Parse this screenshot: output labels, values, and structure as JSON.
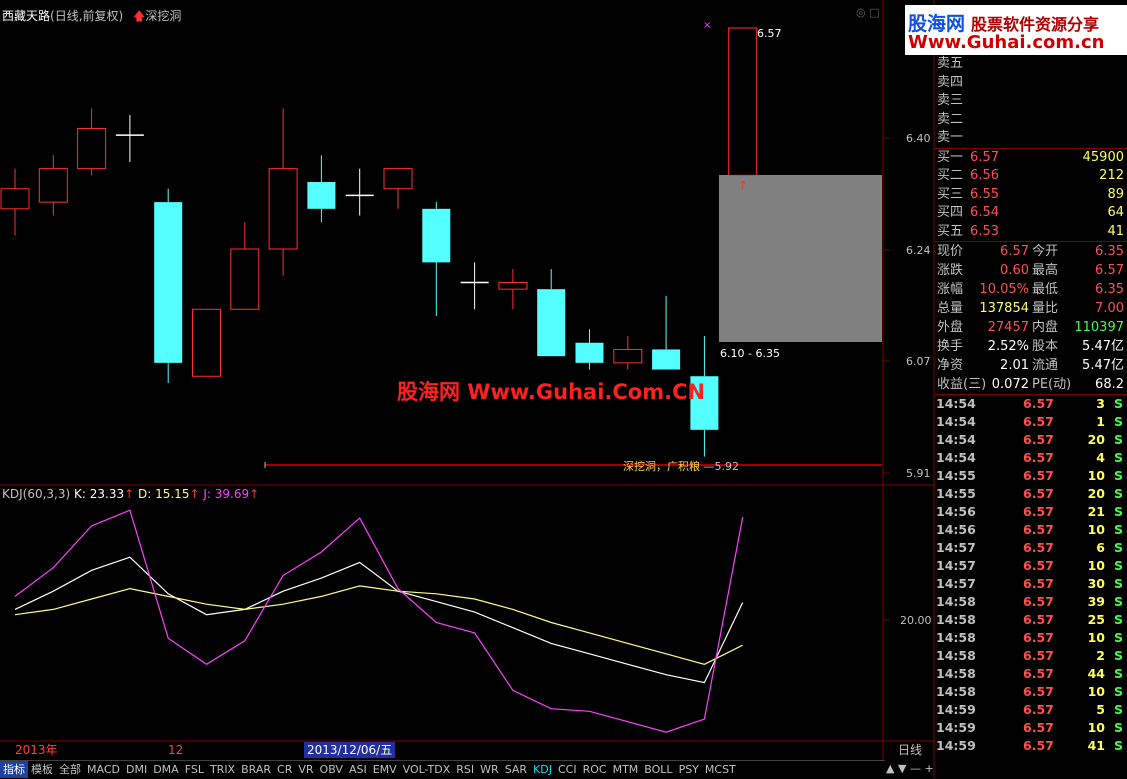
{
  "title": {
    "stock_name": "西藏天路",
    "period": "(日线,前复权)",
    "formula_name": "深挖洞"
  },
  "kdj_header": {
    "name": "KDJ(60,3,3)",
    "k_label": "K: 23.33",
    "d_label": "D: 15.15",
    "j_label": "J: 39.69",
    "arrow": "↑"
  },
  "price_axis": [
    "6.40",
    "6.24",
    "6.07",
    "5.91"
  ],
  "kdj_axis": [
    "20.00"
  ],
  "annotations": {
    "high_label": "6.57",
    "zone_label": "6.10 - 6.35",
    "support_text": "深挖洞，广积粮",
    "support_value": "5.92",
    "high_marker": "×"
  },
  "watermark": "股海网 Www.Guhai.Com.CN",
  "logo": {
    "line1": "股海网",
    "line1_sub": "股票软件资源分享",
    "line2": "Www.Guhai.com.cn"
  },
  "date_bar": {
    "year": "2013年",
    "month": "12",
    "cursor_date": "2013/12/06/五"
  },
  "period_button": "日线",
  "bottom_tabs": [
    "指标",
    "模板",
    "全部",
    "MACD",
    "DMI",
    "DMA",
    "FSL",
    "TRIX",
    "BRAR",
    "CR",
    "VR",
    "OBV",
    "ASI",
    "EMV",
    "VOL-TDX",
    "RSI",
    "WR",
    "SAR",
    "KDJ",
    "CCI",
    "ROC",
    "MTM",
    "BOLL",
    "PSY",
    "MCST"
  ],
  "active_tab": "KDJ",
  "sell_orders": [
    {
      "label": "卖五"
    },
    {
      "label": "卖四"
    },
    {
      "label": "卖三"
    },
    {
      "label": "卖二"
    },
    {
      "label": "卖一"
    }
  ],
  "buy_orders": [
    {
      "label": "买一",
      "price": "6.57",
      "volume": "45900"
    },
    {
      "label": "买二",
      "price": "6.56",
      "volume": "212"
    },
    {
      "label": "买三",
      "price": "6.55",
      "volume": "89"
    },
    {
      "label": "买四",
      "price": "6.54",
      "volume": "64"
    },
    {
      "label": "买五",
      "price": "6.53",
      "volume": "41"
    }
  ],
  "stats": [
    {
      "l1": "现价",
      "v1": "6.57",
      "c1": "red",
      "l2": "今开",
      "v2": "6.35",
      "c2": "red"
    },
    {
      "l1": "涨跌",
      "v1": "0.60",
      "c1": "red",
      "l2": "最高",
      "v2": "6.57",
      "c2": "red"
    },
    {
      "l1": "涨幅",
      "v1": "10.05%",
      "c1": "red",
      "l2": "最低",
      "v2": "6.35",
      "c2": "red"
    },
    {
      "l1": "总量",
      "v1": "137854",
      "c1": "yellow",
      "l2": "量比",
      "v2": "7.00",
      "c2": "red"
    },
    {
      "l1": "外盘",
      "v1": "27457",
      "c1": "red",
      "l2": "内盘",
      "v2": "110397",
      "c2": "green"
    },
    {
      "l1": "换手",
      "v1": "2.52%",
      "c1": "white",
      "l2": "股本",
      "v2": "5.47亿",
      "c2": "white"
    },
    {
      "l1": "净资",
      "v1": "2.01",
      "c1": "white",
      "l2": "流通",
      "v2": "5.47亿",
      "c2": "white"
    },
    {
      "l1": "收益(三)",
      "v1": "0.072",
      "c1": "white",
      "l2": "PE(动)",
      "v2": "68.2",
      "c2": "white"
    }
  ],
  "ticks": [
    {
      "time": "14:54",
      "price": "6.57",
      "vol": "3",
      "bs": "S"
    },
    {
      "time": "14:54",
      "price": "6.57",
      "vol": "1",
      "bs": "S"
    },
    {
      "time": "14:54",
      "price": "6.57",
      "vol": "20",
      "bs": "S"
    },
    {
      "time": "14:54",
      "price": "6.57",
      "vol": "4",
      "bs": "S"
    },
    {
      "time": "14:55",
      "price": "6.57",
      "vol": "10",
      "bs": "S"
    },
    {
      "time": "14:55",
      "price": "6.57",
      "vol": "20",
      "bs": "S"
    },
    {
      "time": "14:56",
      "price": "6.57",
      "vol": "21",
      "bs": "S"
    },
    {
      "time": "14:56",
      "price": "6.57",
      "vol": "10",
      "bs": "S"
    },
    {
      "time": "14:57",
      "price": "6.57",
      "vol": "6",
      "bs": "S"
    },
    {
      "time": "14:57",
      "price": "6.57",
      "vol": "10",
      "bs": "S"
    },
    {
      "time": "14:57",
      "price": "6.57",
      "vol": "30",
      "bs": "S"
    },
    {
      "time": "14:58",
      "price": "6.57",
      "vol": "39",
      "bs": "S"
    },
    {
      "time": "14:58",
      "price": "6.57",
      "vol": "25",
      "bs": "S"
    },
    {
      "time": "14:58",
      "price": "6.57",
      "vol": "10",
      "bs": "S"
    },
    {
      "time": "14:58",
      "price": "6.57",
      "vol": "2",
      "bs": "S"
    },
    {
      "time": "14:58",
      "price": "6.57",
      "vol": "44",
      "bs": "S"
    },
    {
      "time": "14:58",
      "price": "6.57",
      "vol": "10",
      "bs": "S"
    },
    {
      "time": "14:59",
      "price": "6.57",
      "vol": "5",
      "bs": "S"
    },
    {
      "time": "14:59",
      "price": "6.57",
      "vol": "10",
      "bs": "S"
    },
    {
      "time": "14:59",
      "price": "6.57",
      "vol": "41",
      "bs": "S"
    }
  ],
  "colors": {
    "up": "#ff3030",
    "down": "#54ffff",
    "k_line": "#ffffff",
    "d_line": "#ffff80",
    "j_line": "#ff40ff",
    "zone": "#808080",
    "support_line": "#a00000"
  },
  "chart_data": [
    {
      "type": "candlestick",
      "title": "西藏天路",
      "ylim": [
        5.91,
        6.57
      ],
      "candles": [
        {
          "open": 6.3,
          "close": 6.33,
          "high": 6.36,
          "low": 6.26
        },
        {
          "open": 6.31,
          "close": 6.36,
          "high": 6.38,
          "low": 6.29
        },
        {
          "open": 6.36,
          "close": 6.42,
          "high": 6.45,
          "low": 6.35
        },
        {
          "open": 6.41,
          "close": 6.41,
          "high": 6.44,
          "low": 6.37
        },
        {
          "open": 6.31,
          "close": 6.07,
          "high": 6.33,
          "low": 6.04
        },
        {
          "open": 6.05,
          "close": 6.15,
          "high": 6.15,
          "low": 6.05
        },
        {
          "open": 6.15,
          "close": 6.24,
          "high": 6.28,
          "low": 6.15
        },
        {
          "open": 6.24,
          "close": 6.36,
          "high": 6.45,
          "low": 6.2
        },
        {
          "open": 6.34,
          "close": 6.3,
          "high": 6.38,
          "low": 6.28
        },
        {
          "open": 6.32,
          "close": 6.32,
          "high": 6.36,
          "low": 6.29
        },
        {
          "open": 6.33,
          "close": 6.36,
          "high": 6.36,
          "low": 6.3
        },
        {
          "open": 6.3,
          "close": 6.22,
          "high": 6.31,
          "low": 6.14
        },
        {
          "open": 6.19,
          "close": 6.19,
          "high": 6.22,
          "low": 6.15
        },
        {
          "open": 6.18,
          "close": 6.19,
          "high": 6.21,
          "low": 6.15
        },
        {
          "open": 6.18,
          "close": 6.08,
          "high": 6.21,
          "low": 6.08
        },
        {
          "open": 6.1,
          "close": 6.07,
          "high": 6.12,
          "low": 6.06
        },
        {
          "open": 6.07,
          "close": 6.09,
          "high": 6.11,
          "low": 6.06
        },
        {
          "open": 6.09,
          "close": 6.06,
          "high": 6.17,
          "low": 6.06
        },
        {
          "open": 6.05,
          "close": 5.97,
          "high": 6.11,
          "low": 5.93
        },
        {
          "open": 6.35,
          "close": 6.57,
          "high": 6.57,
          "low": 6.35
        }
      ]
    },
    {
      "type": "line",
      "title": "KDJ(60,3,3)",
      "series": [
        {
          "name": "K",
          "values": [
            22,
            25.5,
            29.5,
            32,
            25,
            21,
            22,
            25.5,
            28,
            31,
            25.5,
            23.5,
            21.5,
            18.5,
            15.5,
            13.5,
            11.5,
            9.5,
            8,
            23.33
          ]
        },
        {
          "name": "D",
          "values": [
            21,
            22,
            24,
            26,
            24.5,
            23,
            22,
            23,
            24.5,
            26.5,
            25.5,
            25,
            24,
            22,
            19.5,
            17.5,
            15.5,
            13.5,
            11.5,
            15.15
          ]
        },
        {
          "name": "J",
          "values": [
            24.5,
            30,
            38,
            41,
            16.5,
            11.5,
            16,
            28.5,
            33,
            39.5,
            26,
            19.5,
            17.5,
            6.5,
            3,
            2.5,
            0.5,
            -1.5,
            1,
            39.69
          ]
        }
      ],
      "ytick": [
        20
      ]
    }
  ]
}
